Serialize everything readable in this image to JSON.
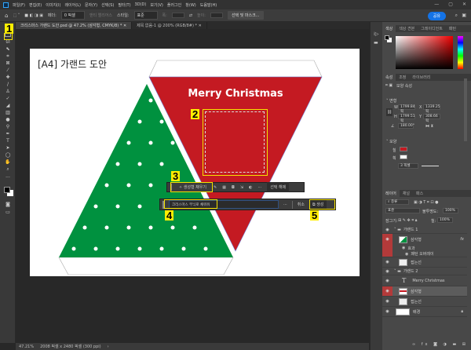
{
  "menu": [
    "파일(F)",
    "편집(E)",
    "이미지(I)",
    "레이어(L)",
    "문자(Y)",
    "선택(S)",
    "필터(T)",
    "3D(D)",
    "보기(V)",
    "플러그인",
    "창(W)",
    "도움말(H)"
  ],
  "options": {
    "feather_label": "페더:",
    "feather_value": "0 픽셀",
    "antialias": "앤티 앨리어스",
    "style_label": "스타일:",
    "style_value": "표준",
    "width_label": "폭:",
    "height_label": "높이:",
    "select_mask": "선택 및 마스크...",
    "share": "공유"
  },
  "doc_tabs": [
    "크리스마스 가랜드 도안.psd @ 47.2% (삼각형, CMYK/8) *",
    "제목 없음-1 @ 200% (RGB/8#) *"
  ],
  "canvas": {
    "title": "[A4] 가랜드 도안",
    "banner_text": "Merry Christmas",
    "colors": {
      "red": "#c41a22",
      "green": "#00913f"
    }
  },
  "context_bar": {
    "generative_fill": "생성형 채우기",
    "deselect": "선택 해제",
    "more": "···"
  },
  "prompt_bar": {
    "prompt": "크리스마스 무늬로 채워줘",
    "more": "···",
    "cancel": "취소",
    "generate": "생성"
  },
  "annotations": [
    "1",
    "2",
    "3",
    "4",
    "5"
  ],
  "status": {
    "zoom": "47.21%",
    "doc_size": "2008 픽셀 x 2480 픽셀 (300 ppi)"
  },
  "color_panel": {
    "tabs": [
      "색상",
      "색상 견본",
      "그레이디언트",
      "패턴"
    ]
  },
  "properties": {
    "tabs": [
      "속성",
      "조정",
      "라이브러리"
    ],
    "kind": "모양 속성",
    "transform": "변형",
    "w": "1799.84 픽",
    "x": "1339.25 픽",
    "h": "1799.51 픽",
    "y": "308.66 픽",
    "angle": "180.00°",
    "appearance": "모양",
    "fill": "칠",
    "stroke": "획",
    "stroke_width": "3 픽셀",
    "w_label": "W",
    "h_label": "H",
    "x_label": "X",
    "y_label": "Y"
  },
  "layers_panel": {
    "tabs": [
      "레이어",
      "채널",
      "패스"
    ],
    "filter": "종류",
    "blend": "표준",
    "opacity_label": "불투명도:",
    "opacity": "100%",
    "lock_label": "잠그기:",
    "fill_label": "칠:",
    "fill": "100%",
    "layers": [
      {
        "name": "가랜드 1",
        "type": "group"
      },
      {
        "name": "삼각형",
        "type": "shape",
        "fx": "fx"
      },
      {
        "name": "효과",
        "type": "effect"
      },
      {
        "name": "패턴 오버레이",
        "type": "effect"
      },
      {
        "name": "접는선",
        "type": "shape"
      },
      {
        "name": "가랜드 2",
        "type": "group"
      },
      {
        "name": "Merry Christmas",
        "type": "text"
      },
      {
        "name": "삼각형",
        "type": "shape",
        "selected": true
      },
      {
        "name": "접는선",
        "type": "shape"
      },
      {
        "name": "배경",
        "type": "background"
      }
    ]
  }
}
